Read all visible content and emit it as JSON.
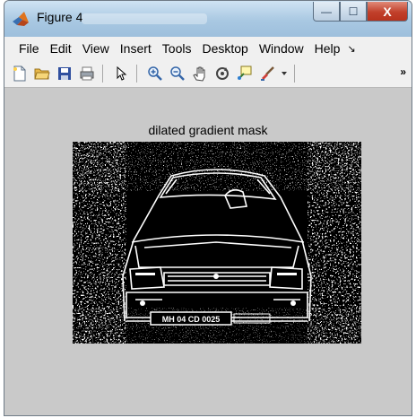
{
  "window": {
    "title": "Figure 4",
    "controls": {
      "minimize": "—",
      "maximize": "☐",
      "close": "X"
    }
  },
  "menubar": {
    "items": [
      "File",
      "Edit",
      "View",
      "Insert",
      "Tools",
      "Desktop",
      "Window",
      "Help"
    ]
  },
  "toolbar": {
    "tools": [
      "new-figure",
      "open-file",
      "save-figure",
      "print-figure",
      "edit-plot",
      "zoom-in",
      "zoom-out",
      "pan",
      "rotate-3d",
      "data-cursor",
      "brush",
      "brush-dropdown"
    ],
    "overflow": "»"
  },
  "figure": {
    "title": "dilated gradient mask",
    "plate_text": "MH 04 CD 0025"
  },
  "colors": {
    "titlebar": "#a9c8e2",
    "window_bg": "#c9c9c9",
    "menu_bg": "#f0f0f0",
    "close": "#c1402b"
  }
}
